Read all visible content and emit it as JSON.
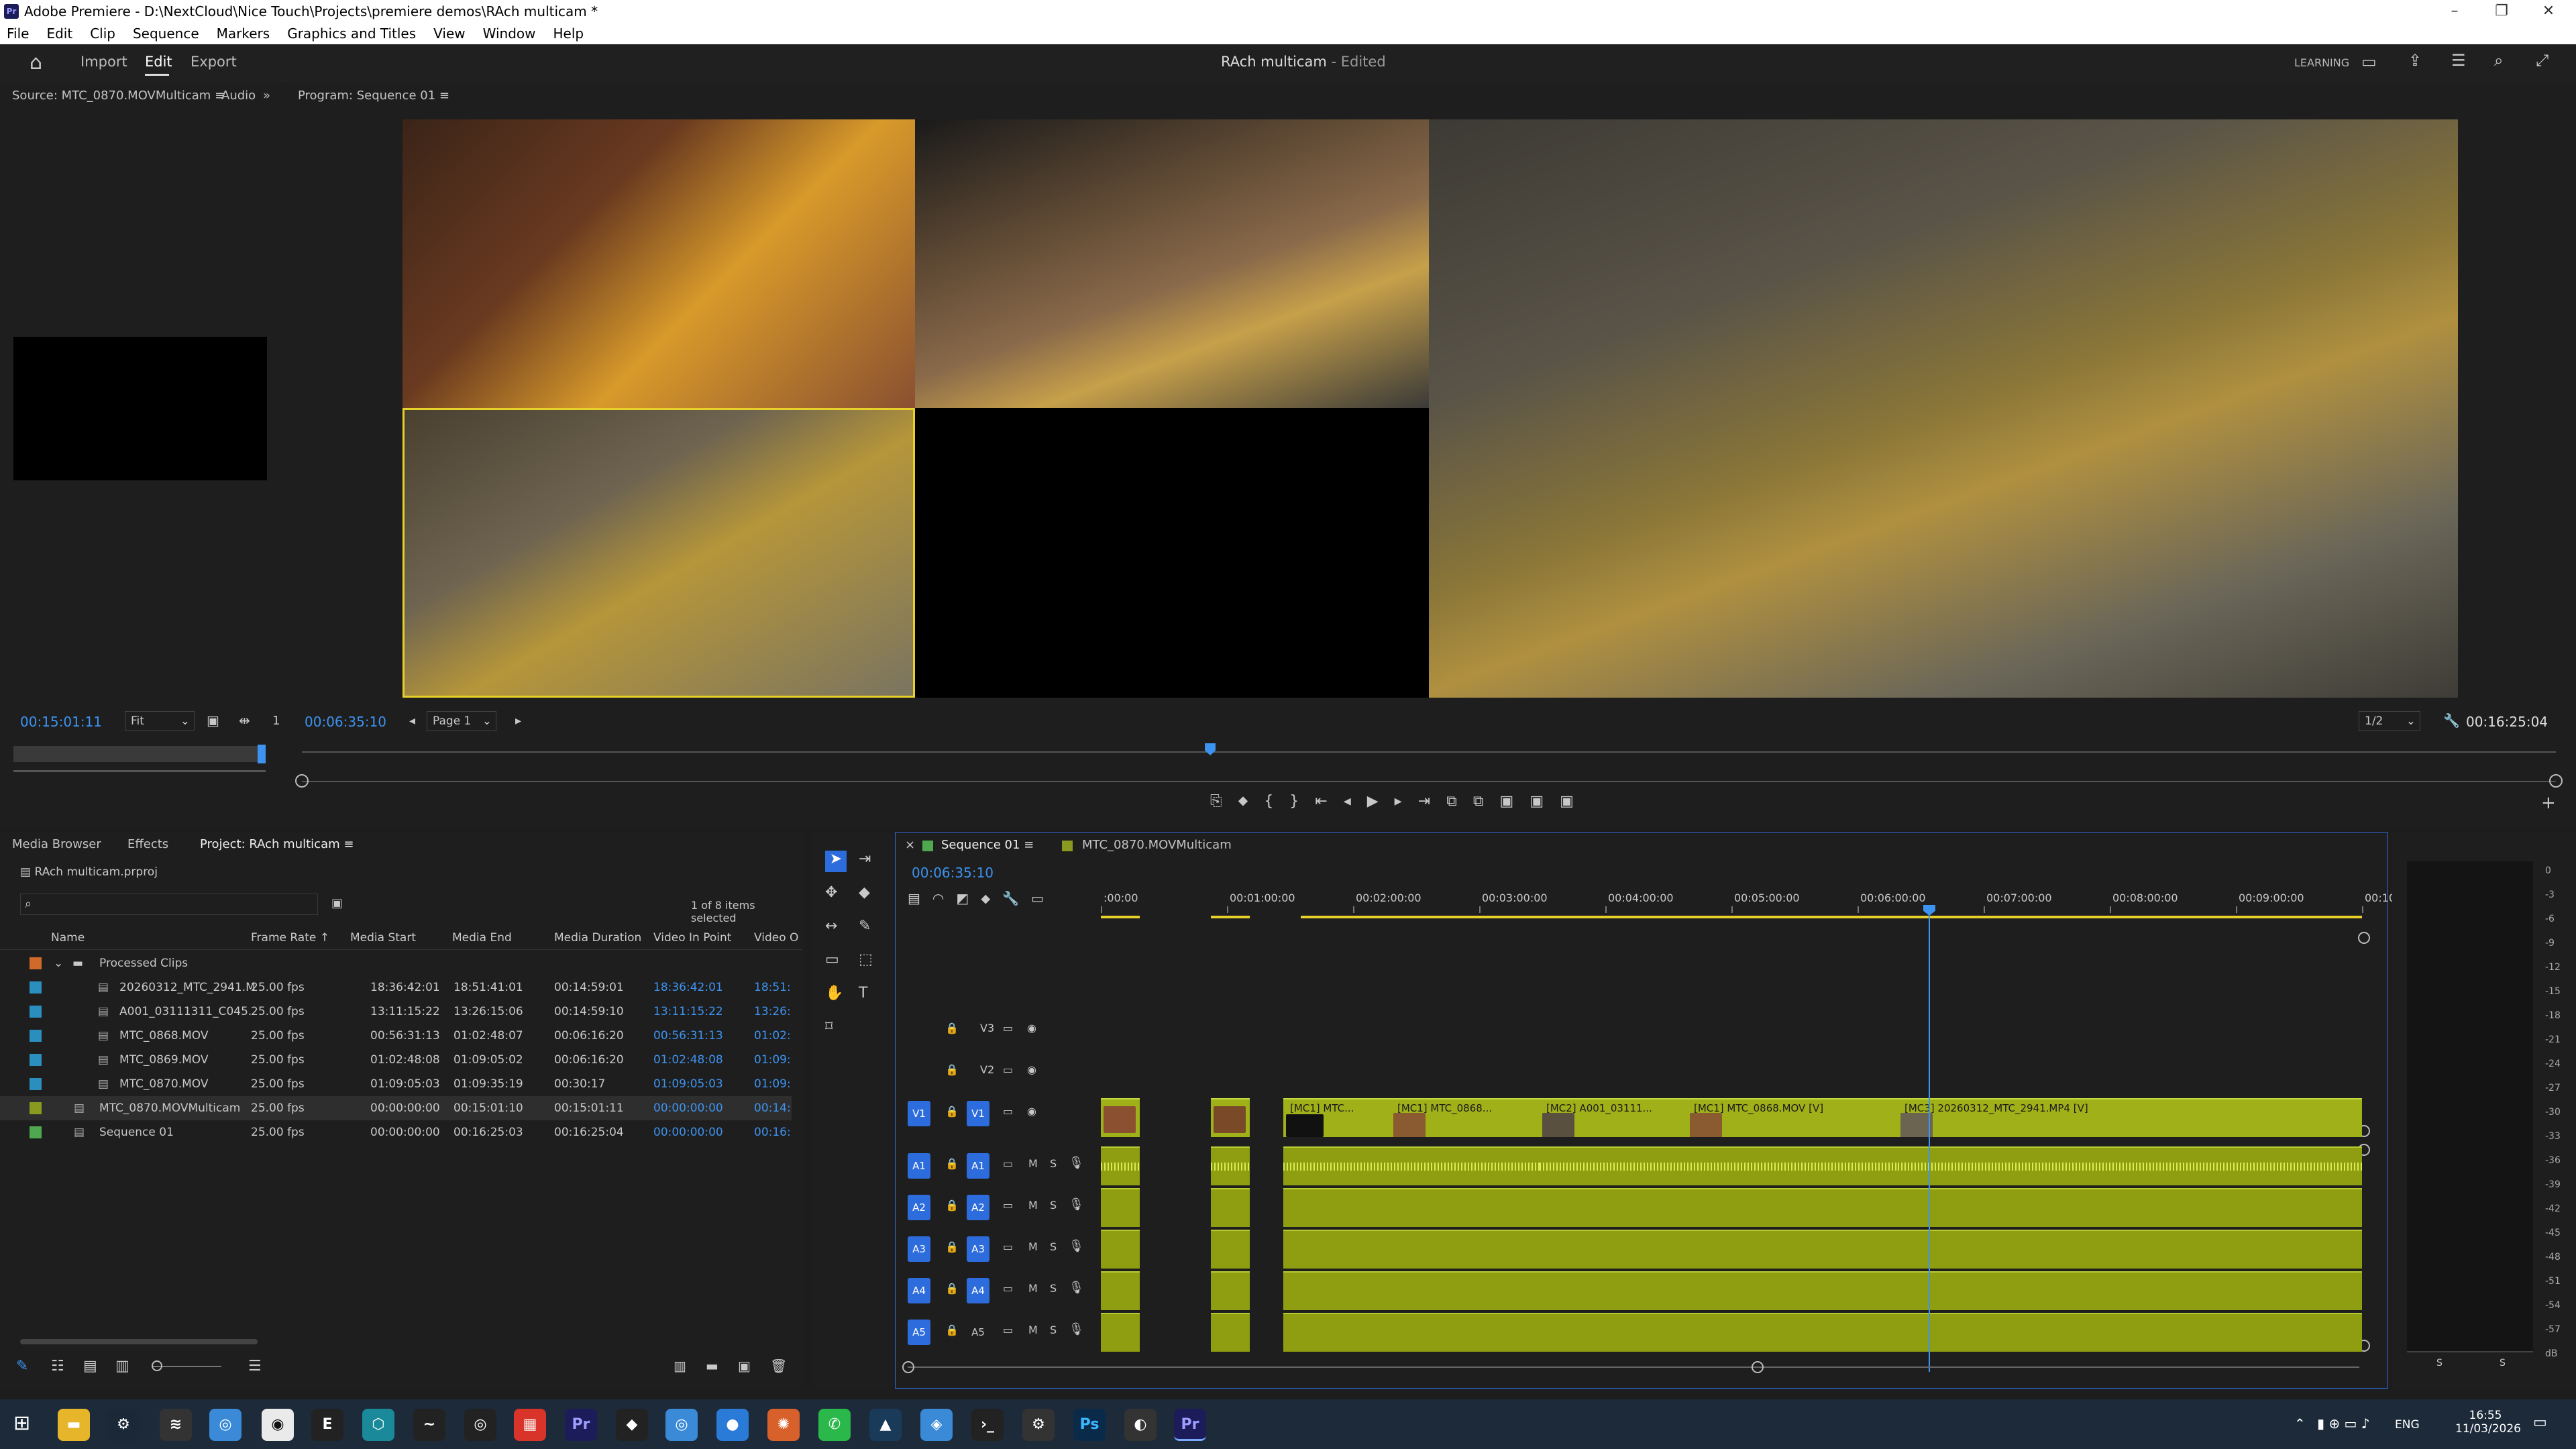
{
  "window": {
    "title": "Adobe Premiere - D:\\NextCloud\\Nice Touch\\Projects\\premiere demos\\RAch multicam *",
    "app_icon": "Pr"
  },
  "menu": [
    "File",
    "Edit",
    "Clip",
    "Sequence",
    "Markers",
    "Graphics and Titles",
    "View",
    "Window",
    "Help"
  ],
  "workspace": {
    "tabs": [
      "Import",
      "Edit",
      "Export"
    ],
    "active": "Edit",
    "project_title": "RAch multicam",
    "status": "- Edited",
    "learning": "LEARNING"
  },
  "source_monitor": {
    "tab": "Source: MTC_0870.MOVMulticam",
    "tab2": "Audio",
    "timecode": "00:15:01:11",
    "fit": "Fit",
    "page_marker": "1"
  },
  "program_monitor": {
    "tab": "Program: Sequence 01",
    "timecode_left": "00:06:35:10",
    "page": "Page 1",
    "resolution": "1/2",
    "timecode_right": "00:16:25:04",
    "playhead_fraction": 0.403
  },
  "project_panel": {
    "tabs": [
      "Media Browser",
      "Effects",
      "Project: RAch multicam"
    ],
    "project_file": "RAch multicam.prproj",
    "selection": "1 of 8 items selected",
    "columns": [
      "Name",
      "Frame Rate",
      "Media Start",
      "Media End",
      "Media Duration",
      "Video In Point",
      "Video O"
    ],
    "folder": "Processed Clips",
    "rows": [
      {
        "name": "20260312_MTC_2941.M",
        "rate": "25.00 fps",
        "start": "18:36:42:01",
        "end": "18:51:41:01",
        "duration": "00:14:59:01",
        "vin": "18:36:42:01",
        "vout": "18:51:",
        "color": "#2a8fbf"
      },
      {
        "name": "A001_03111311_C045.",
        "rate": "25.00 fps",
        "start": "13:11:15:22",
        "end": "13:26:15:06",
        "duration": "00:14:59:10",
        "vin": "13:11:15:22",
        "vout": "13:26:",
        "color": "#2a8fbf"
      },
      {
        "name": "MTC_0868.MOV",
        "rate": "25.00 fps",
        "start": "00:56:31:13",
        "end": "01:02:48:07",
        "duration": "00:06:16:20",
        "vin": "00:56:31:13",
        "vout": "01:02:",
        "color": "#2a8fbf"
      },
      {
        "name": "MTC_0869.MOV",
        "rate": "25.00 fps",
        "start": "01:02:48:08",
        "end": "01:09:05:02",
        "duration": "00:06:16:20",
        "vin": "01:02:48:08",
        "vout": "01:09:",
        "color": "#2a8fbf"
      },
      {
        "name": "MTC_0870.MOV",
        "rate": "25.00 fps",
        "start": "01:09:05:03",
        "end": "01:09:35:19",
        "duration": "00:30:17",
        "vin": "01:09:05:03",
        "vout": "01:09:",
        "color": "#2a8fbf"
      },
      {
        "name": "MTC_0870.MOVMulticam",
        "rate": "25.00 fps",
        "start": "00:00:00:00",
        "end": "00:15:01:10",
        "duration": "00:15:01:11",
        "vin": "00:00:00:00",
        "vout": "00:14:",
        "color": "#8a9a20"
      },
      {
        "name": "Sequence 01",
        "rate": "25.00 fps",
        "start": "00:00:00:00",
        "end": "00:16:25:03",
        "duration": "00:16:25:04",
        "vin": "00:00:00:00",
        "vout": "00:16:",
        "color": "#4fa84f"
      }
    ]
  },
  "timeline": {
    "tabs": [
      "Sequence 01",
      "MTC_0870.MOVMulticam"
    ],
    "timecode": "00:06:35:10",
    "ruler": [
      ":00:00",
      "00:01:00:00",
      "00:02:00:00",
      "00:03:00:00",
      "00:04:00:00",
      "00:05:00:00",
      "00:06:00:00",
      "00:07:00:00",
      "00:08:00:00",
      "00:09:00:00",
      "00:10"
    ],
    "video_tracks": [
      "V3",
      "V2",
      "V1"
    ],
    "audio_tracks": [
      "A1",
      "A2",
      "A3",
      "A4",
      "A5"
    ],
    "clips": [
      "[MC1] MTC...",
      "[MC1] MTC_0868...",
      "[MC2] A001_03111...",
      "[MC1] MTC_0868.MOV [V]",
      "[MC3] 20260312_MTC_2941.MP4 [V]"
    ],
    "mute": "M",
    "solo": "S"
  },
  "meters": {
    "labels": [
      "0",
      "-3",
      "-6",
      "-9",
      "-12",
      "-15",
      "-18",
      "-21",
      "-24",
      "-27",
      "-30",
      "-33",
      "-36",
      "-39",
      "-42",
      "-45",
      "-48",
      "-51",
      "-54",
      "-57",
      "dB"
    ],
    "bottom": [
      "S",
      "S"
    ]
  },
  "taskbar": {
    "time": "16:55",
    "date": "11/03/2026",
    "lang": "ENG"
  }
}
